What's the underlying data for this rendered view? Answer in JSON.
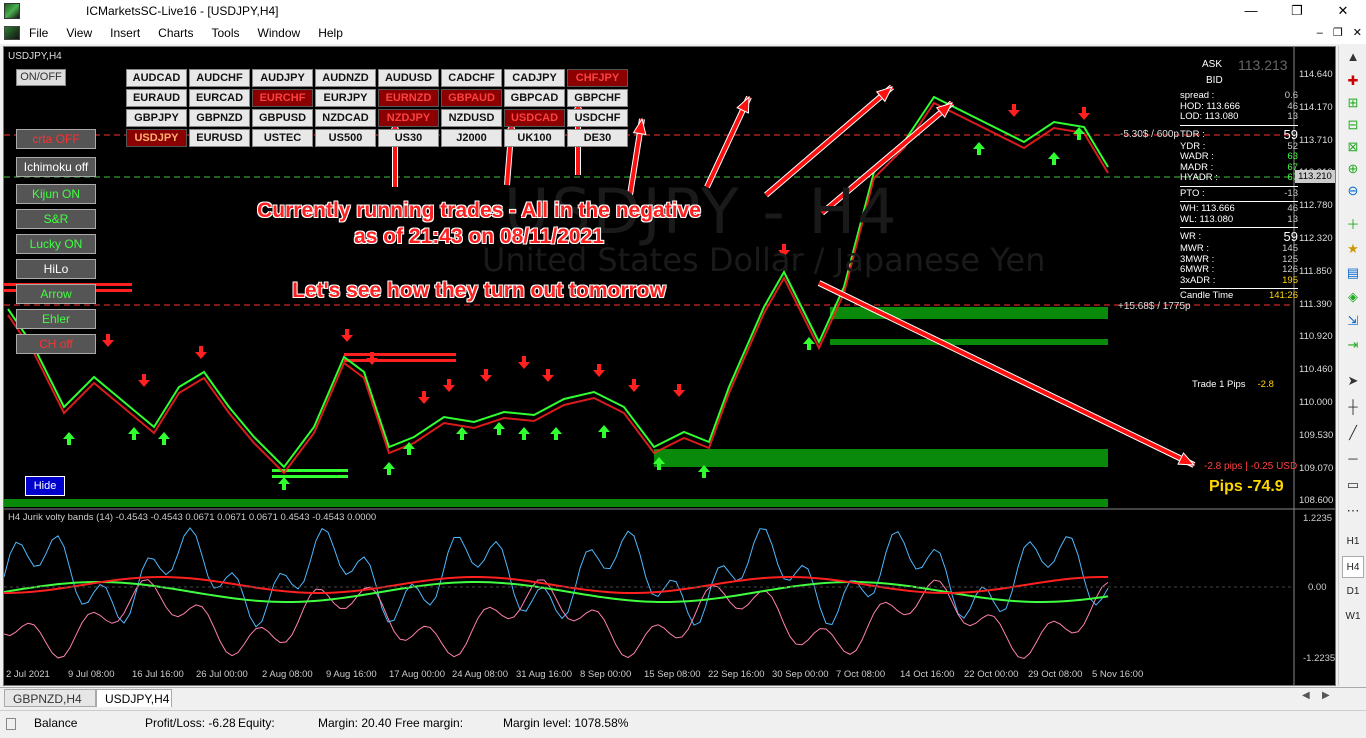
{
  "window": {
    "title": "ICMarketsSC-Live16 - [USDJPY,H4]",
    "minimize": "—",
    "maximize": "❐",
    "close": "✕"
  },
  "menu": [
    "File",
    "View",
    "Insert",
    "Charts",
    "Tools",
    "Window",
    "Help"
  ],
  "mdi": {
    "minimize": "–",
    "restore": "❐",
    "close": "✕"
  },
  "chart": {
    "symbol_label": "USDJPY,H4",
    "onoff": "ON/OFF",
    "side_buttons": [
      {
        "label": "crta OFF",
        "color": "#ff3030"
      },
      {
        "label": "Ichimoku off",
        "color": "#ffffff"
      },
      {
        "label": "Kijun ON",
        "color": "#40ff40"
      },
      {
        "label": "S&R",
        "color": "#40ff40"
      },
      {
        "label": "Lucky ON",
        "color": "#40ff40"
      },
      {
        "label": "HiLo",
        "color": "#ffffff"
      },
      {
        "label": "Arrow",
        "color": "#40ff40"
      },
      {
        "label": "Ehler",
        "color": "#40ff40"
      },
      {
        "label": "CH off",
        "color": "#ff3030"
      }
    ],
    "hide_button": "Hide",
    "pairs_row1": [
      {
        "label": "AUDCAD",
        "state": "normal"
      },
      {
        "label": "AUDCHF",
        "state": "normal"
      },
      {
        "label": "AUDJPY",
        "state": "normal"
      },
      {
        "label": "AUDNZD",
        "state": "normal"
      },
      {
        "label": "AUDUSD",
        "state": "normal"
      },
      {
        "label": "CADCHF",
        "state": "normal"
      },
      {
        "label": "CADJPY",
        "state": "normal"
      },
      {
        "label": "CHFJPY",
        "state": "red"
      },
      {
        "label": "EURAUD",
        "state": "normal"
      },
      {
        "label": "EURCAD",
        "state": "normal"
      },
      {
        "label": "EURCHF",
        "state": "red"
      },
      {
        "label": "EURJPY",
        "state": "normal"
      },
      {
        "label": "EURNZD",
        "state": "red"
      },
      {
        "label": "GBPAUD",
        "state": "red"
      },
      {
        "label": "GBPCAD",
        "state": "normal"
      },
      {
        "label": "GBPCHF",
        "state": "normal"
      }
    ],
    "pairs_row2": [
      {
        "label": "GBPJPY",
        "state": "normal"
      },
      {
        "label": "GBPNZD",
        "state": "normal"
      },
      {
        "label": "GBPUSD",
        "state": "normal"
      },
      {
        "label": "NZDCAD",
        "state": "normal"
      },
      {
        "label": "NZDJPY",
        "state": "red"
      },
      {
        "label": "NZDUSD",
        "state": "normal"
      },
      {
        "label": "USDCAD",
        "state": "red"
      },
      {
        "label": "USDCHF",
        "state": "normal"
      },
      {
        "label": "USDJPY",
        "state": "redw"
      },
      {
        "label": "EURUSD",
        "state": "normal"
      },
      {
        "label": "USTEC",
        "state": "normal"
      },
      {
        "label": "US500",
        "state": "normal"
      },
      {
        "label": "US30",
        "state": "normal"
      },
      {
        "label": "J2000",
        "state": "normal"
      },
      {
        "label": "UK100",
        "state": "normal"
      },
      {
        "label": "DE30",
        "state": "normal"
      }
    ],
    "annotation_line1": "Currently running trades - All in the negative",
    "annotation_line2": "as of 21:43 on 08/11/2021",
    "annotation_line3": "Let's see how they turn out tomorrow",
    "watermark_symbol": "USDJPY - H4",
    "watermark_desc": "United States Dollar / Japanese Yen",
    "level_label_top": "-5.30$ / 600p",
    "level_label_mid": "+15.68$ / 1775p",
    "ask_label": "ASK",
    "ask_value": "113.213",
    "bid_label": "BID",
    "stats": [
      {
        "k": "spread :",
        "v": "0.6"
      },
      {
        "k": "HOD: 113.666",
        "v": "46",
        "kc": "#ffffff"
      },
      {
        "k": "LOD: 113.080",
        "v": "13",
        "kc": "#ffffff"
      },
      {
        "k": "TDR :",
        "v": "59",
        "big": true
      },
      {
        "k": "YDR :",
        "v": "52"
      },
      {
        "k": "WADR :",
        "v": "63",
        "vc": "#40ff40"
      },
      {
        "k": "MADR :",
        "v": "67",
        "vc": "#40ff40"
      },
      {
        "k": "HYADR :",
        "v": "67",
        "vc": "#40ff40"
      },
      {
        "k": "PTO :",
        "v": "-13"
      },
      {
        "k": "WH: 113.666",
        "v": "46"
      },
      {
        "k": "WL: 113.080",
        "v": "13"
      },
      {
        "k": "WR :",
        "v": "59",
        "big": true
      },
      {
        "k": "MWR :",
        "v": "145"
      },
      {
        "k": "3MWR :",
        "v": "125"
      },
      {
        "k": "6MWR :",
        "v": "126"
      },
      {
        "k": "3xADR :",
        "v": "195",
        "vc": "#ffd700"
      },
      {
        "k": "Candle Time",
        "v": "141:26",
        "vc": "#ffd700"
      }
    ],
    "price_axis": [
      "114.640",
      "114.170",
      "113.710",
      "113.210",
      "112.780",
      "112.320",
      "111.850",
      "111.390",
      "110.920",
      "110.460",
      "110.000",
      "109.530",
      "109.070",
      "108.600"
    ],
    "current_price": "113.210",
    "trade1_label": "Trade 1 Pips",
    "trade1_value": "-2.8",
    "pips_line": "-2.8 pips | -0.25 USD",
    "pips_total": "Pips -74.9",
    "indicator_label": "H4 Jurik volty bands (14) -0.4543 -0.4543 0.0671 0.0671 0.0671 0.4543 -0.4543 0.0000",
    "indicator_axis": [
      "1.2235",
      "0.00",
      "-1.2235"
    ],
    "dates": [
      "2 Jul 2021",
      "9 Jul 08:00",
      "16 Jul 16:00",
      "26 Jul 00:00",
      "2 Aug 08:00",
      "9 Aug 16:00",
      "17 Aug 00:00",
      "24 Aug 08:00",
      "31 Aug 16:00",
      "8 Sep 00:00",
      "15 Sep 08:00",
      "22 Sep 16:00",
      "30 Sep 00:00",
      "7 Oct 08:00",
      "14 Oct 16:00",
      "22 Oct 00:00",
      "29 Oct 08:00",
      "5 Nov 16:00"
    ]
  },
  "tabs": [
    "GBPNZD,H4",
    "USDJPY,H4"
  ],
  "status": {
    "balance": "Balance",
    "pl": "Profit/Loss: -6.28",
    "equity": "Equity:",
    "margin": "Margin: 20.40",
    "free": "Free margin:",
    "level": "Margin level: 1078.58%"
  },
  "timeframes": [
    "H1",
    "H4",
    "D1",
    "W1"
  ],
  "colors": {
    "bull": "#40ff40",
    "bear": "#ff2020",
    "annotation": "#ff2020",
    "accent": "#ffd700"
  }
}
